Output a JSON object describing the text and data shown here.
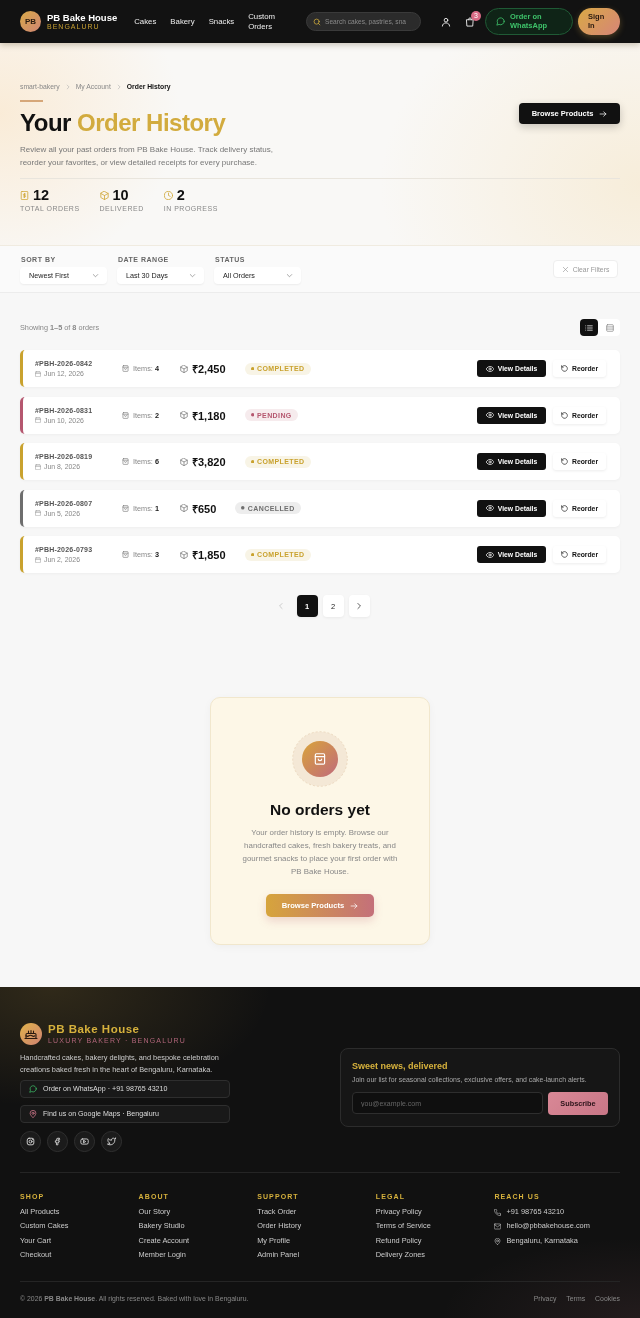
{
  "header": {
    "logo_mark": "PB",
    "brand": "PB Bake House",
    "tagline": "BENGALURU",
    "nav": [
      "Cakes",
      "Bakery",
      "Snacks",
      "Custom Orders"
    ],
    "search": {
      "placeholder": "Search cakes, pastries, sna"
    },
    "cart_count": "3",
    "whatsapp": "Order on WhatsApp",
    "sign_in": "Sign In"
  },
  "hero": {
    "breadcrumb": [
      "smart-bakery",
      "My Account",
      "Order History"
    ],
    "title_lead": "Your",
    "title_highlight": "Order History",
    "description": "Review all your past orders from PB Bake House. Track delivery status, reorder your favorites, or view detailed receipts for every purchase.",
    "stats": [
      {
        "value": "12",
        "label": "TOTAL ORDERS"
      },
      {
        "value": "10",
        "label": "DELIVERED"
      },
      {
        "value": "2",
        "label": "IN PROGRESS"
      }
    ],
    "browse_button": "Browse Products"
  },
  "filters": {
    "groups": [
      {
        "label": "SORT BY",
        "value": "Newest First"
      },
      {
        "label": "DATE RANGE",
        "value": "Last 30 Days"
      },
      {
        "label": "STATUS",
        "value": "All Orders"
      }
    ],
    "clear_button": "Clear Filters"
  },
  "results": {
    "summary": "Showing **1–5** of **8** orders",
    "view_toggle": [
      {
        "selected": true
      },
      {
        "selected": false
      }
    ]
  },
  "orders": [
    {
      "id": "#PBH-2026-0842",
      "date": "Jun 12, 2026",
      "items_label": "Items:",
      "items": "4",
      "total": "₹2,450",
      "status": "COMPLETED",
      "color": "#c9a22e",
      "view_button": "View Details",
      "reorder_button": "Reorder"
    },
    {
      "id": "#PBH-2026-0831",
      "date": "Jun 10, 2026",
      "items_label": "Items:",
      "items": "2",
      "total": "₹1,180",
      "status": "PENDING",
      "color": "#b5576f",
      "view_button": "View Details",
      "reorder_button": "Reorder"
    },
    {
      "id": "#PBH-2026-0819",
      "date": "Jun 8, 2026",
      "items_label": "Items:",
      "items": "6",
      "total": "₹3,820",
      "status": "COMPLETED",
      "color": "#c9a22e",
      "view_button": "View Details",
      "reorder_button": "Reorder"
    },
    {
      "id": "#PBH-2026-0807",
      "date": "Jun 5, 2026",
      "items_label": "Items:",
      "items": "1",
      "total": "₹650",
      "status": "CANCELLED",
      "color": "#6e6e6e",
      "view_button": "View Details",
      "reorder_button": "Reorder"
    },
    {
      "id": "#PBH-2026-0793",
      "date": "Jun 2, 2026",
      "items_label": "Items:",
      "items": "3",
      "total": "₹1,850",
      "status": "COMPLETED",
      "color": "#c9a22e",
      "view_button": "View Details",
      "reorder_button": "Reorder"
    }
  ],
  "pagination": {
    "prev": {
      "disabled": true
    },
    "pages": [
      {
        "label": "1",
        "selected": true
      },
      {
        "label": "2",
        "selected": false
      }
    ],
    "next": {
      "disabled": false
    }
  },
  "empty_state": {
    "title": "No orders yet",
    "text": "Your order history is empty. Browse our handcrafted cakes, fresh bakery treats, and gourmet snacks to place your first order with PB Bake House.",
    "button": "Browse Products"
  },
  "footer": {
    "brand": "PB Bake House",
    "tagline": "LUXURY BAKERY · BENGALURU",
    "description": "Handcrafted cakes, bakery delights, and bespoke celebration creations baked fresh in the heart of Bengaluru, Karnataka.",
    "contacts": [
      "Order on WhatsApp · +91 98765 43210",
      "Find us on Google Maps · Bengaluru"
    ],
    "newsletter": {
      "title": "Sweet news, delivered",
      "text": "Join our list for seasonal collections, exclusive offers, and cake-launch alerts.",
      "placeholder": "you@example.com",
      "button": "Subscribe"
    },
    "columns": [
      {
        "heading": "SHOP",
        "links": [
          "All Products",
          "Custom Cakes",
          "Your Cart",
          "Checkout"
        ]
      },
      {
        "heading": "ABOUT",
        "links": [
          "Our Story",
          "Bakery Studio",
          "Create Account",
          "Member Login"
        ]
      },
      {
        "heading": "SUPPORT",
        "links": [
          "Track Order",
          "Order History",
          "My Profile",
          "Admin Panel"
        ]
      },
      {
        "heading": "LEGAL",
        "links": [
          "Privacy Policy",
          "Terms of Service",
          "Refund Policy",
          "Delivery Zones"
        ]
      }
    ],
    "reach_us": {
      "heading": "REACH US",
      "items": [
        "+91 98765 43210",
        "hello@pbbakehouse.com",
        "Bengaluru, Karnataka"
      ]
    },
    "copyright": "© 2026 **PB Bake House**. All rights reserved. Baked with love in Bengaluru.",
    "legal_links": [
      "Privacy",
      "Terms",
      "Cookies"
    ]
  }
}
